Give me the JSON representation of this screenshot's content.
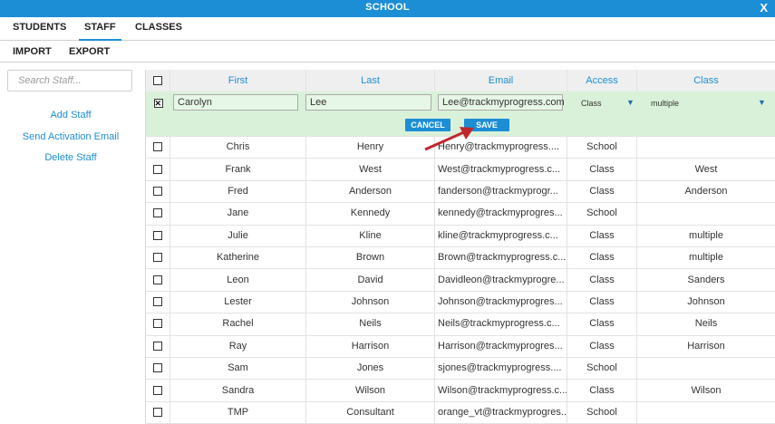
{
  "window": {
    "title": "SCHOOL",
    "close_label": "X"
  },
  "tabs": [
    "STUDENTS",
    "STAFF",
    "CLASSES"
  ],
  "subtabs": [
    "IMPORT",
    "EXPORT"
  ],
  "search": {
    "placeholder": "Search Staff..."
  },
  "sidebar": {
    "links": [
      "Add Staff",
      "Send Activation Email",
      "Delete Staff"
    ]
  },
  "table": {
    "columns": [
      "First",
      "Last",
      "Email",
      "Access",
      "Class"
    ],
    "edit_row": {
      "first": "Carolyn",
      "last": "Lee",
      "email": "Lee@trackmyprogress.com",
      "access": "Class",
      "class": "multiple",
      "cancel_label": "CANCEL",
      "save_label": "SAVE"
    },
    "rows": [
      {
        "first": "Chris",
        "last": "Henry",
        "email": "Henry@trackmyprogress....",
        "access": "School",
        "class": ""
      },
      {
        "first": "Frank",
        "last": "West",
        "email": "West@trackmyprogress.c...",
        "access": "Class",
        "class": "West"
      },
      {
        "first": "Fred",
        "last": "Anderson",
        "email": "fanderson@trackmyprogr...",
        "access": "Class",
        "class": "Anderson"
      },
      {
        "first": "Jane",
        "last": "Kennedy",
        "email": "kennedy@trackmyprogres...",
        "access": "School",
        "class": ""
      },
      {
        "first": "Julie",
        "last": "Kline",
        "email": "kline@trackmyprogress.c...",
        "access": "Class",
        "class": "multiple"
      },
      {
        "first": "Katherine",
        "last": "Brown",
        "email": "Brown@trackmyprogress.c...",
        "access": "Class",
        "class": "multiple"
      },
      {
        "first": "Leon",
        "last": "David",
        "email": "Davidleon@trackmyprogre...",
        "access": "Class",
        "class": "Sanders"
      },
      {
        "first": "Lester",
        "last": "Johnson",
        "email": "Johnson@trackmyprogres...",
        "access": "Class",
        "class": "Johnson"
      },
      {
        "first": "Rachel",
        "last": "Neils",
        "email": "Neils@trackmyprogress.c...",
        "access": "Class",
        "class": "Neils"
      },
      {
        "first": "Ray",
        "last": "Harrison",
        "email": "Harrison@trackmyprogres...",
        "access": "Class",
        "class": "Harrison"
      },
      {
        "first": "Sam",
        "last": "Jones",
        "email": "sjones@trackmyprogress....",
        "access": "School",
        "class": ""
      },
      {
        "first": "Sandra",
        "last": "Wilson",
        "email": "Wilson@trackmyprogress.c...",
        "access": "Class",
        "class": "Wilson"
      },
      {
        "first": "TMP",
        "last": "Consultant",
        "email": "orange_vt@trackmyprogres...",
        "access": "School",
        "class": ""
      }
    ]
  },
  "colors": {
    "accent": "#1c8ed6",
    "edit_row_bg": "#d9f1d9",
    "arrow": "#c0282d"
  }
}
